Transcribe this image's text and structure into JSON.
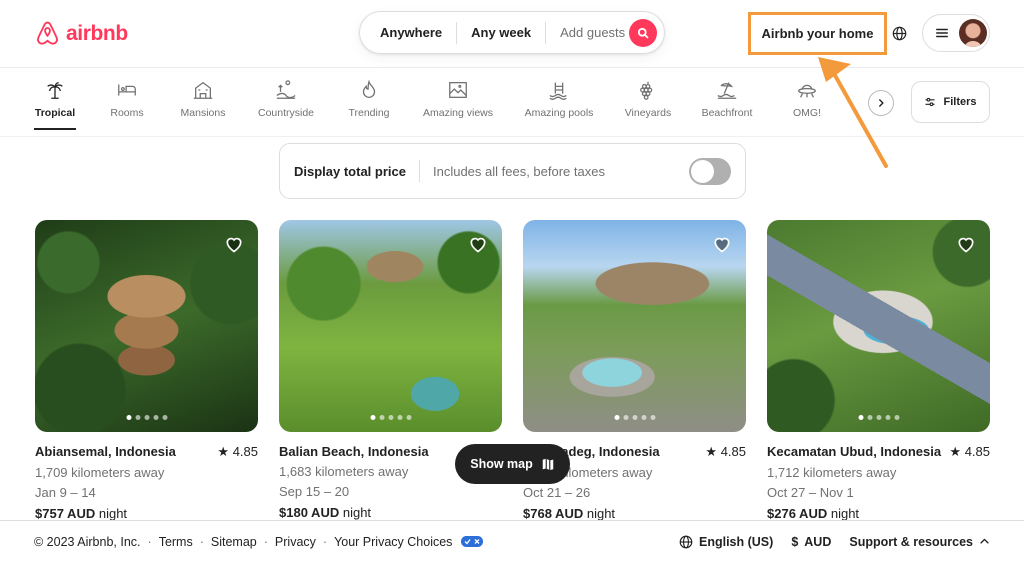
{
  "brand": {
    "name": "airbnb",
    "color": "#FF385C"
  },
  "search": {
    "where": "Anywhere",
    "when": "Any week",
    "guests": "Add guests"
  },
  "header": {
    "host_label": "Airbnb your home",
    "host_highlight_color": "#F39A3C"
  },
  "categories": [
    {
      "label": "Tropical",
      "icon": "palm-tree-icon",
      "active": true
    },
    {
      "label": "Rooms",
      "icon": "bed-icon"
    },
    {
      "label": "Mansions",
      "icon": "mansion-icon"
    },
    {
      "label": "Countryside",
      "icon": "countryside-icon"
    },
    {
      "label": "Trending",
      "icon": "flame-icon"
    },
    {
      "label": "Amazing views",
      "icon": "picture-frame-icon"
    },
    {
      "label": "Amazing pools",
      "icon": "pool-icon"
    },
    {
      "label": "Vineyards",
      "icon": "grapes-icon"
    },
    {
      "label": "Beachfront",
      "icon": "beach-icon"
    },
    {
      "label": "OMG!",
      "icon": "ufo-icon"
    }
  ],
  "filters_label": "Filters",
  "price_display": {
    "title": "Display total price",
    "subtitle": "Includes all fees, before taxes"
  },
  "listings": [
    {
      "location": "Abiansemal, Indonesia",
      "rating": "4.85",
      "distance": "1,709 kilometers away",
      "dates": "Jan 9 – 14",
      "price": "$757 AUD",
      "price_unit": "night"
    },
    {
      "location": "Balian Beach, Indonesia",
      "rating": "",
      "distance": "1,683 kilometers away",
      "dates": "Sep 15 – 20",
      "price": "$180 AUD",
      "price_unit": "night"
    },
    {
      "location": "Selemadeg, Indonesia",
      "rating": "4.85",
      "distance": "1,699 kilometers away",
      "dates": "Oct 21 – 26",
      "price": "$768 AUD",
      "price_unit": "night"
    },
    {
      "location": "Kecamatan Ubud, Indonesia",
      "rating": "4.85",
      "distance": "1,712 kilometers away",
      "dates": "Oct 27 – Nov 1",
      "price": "$276 AUD",
      "price_unit": "night"
    }
  ],
  "show_map_label": "Show map",
  "footer": {
    "copyright": "© 2023 Airbnb, Inc.",
    "links": [
      "Terms",
      "Sitemap",
      "Privacy",
      "Your Privacy Choices"
    ],
    "language": "English (US)",
    "currency_symbol": "$",
    "currency": "AUD",
    "support": "Support & resources"
  }
}
